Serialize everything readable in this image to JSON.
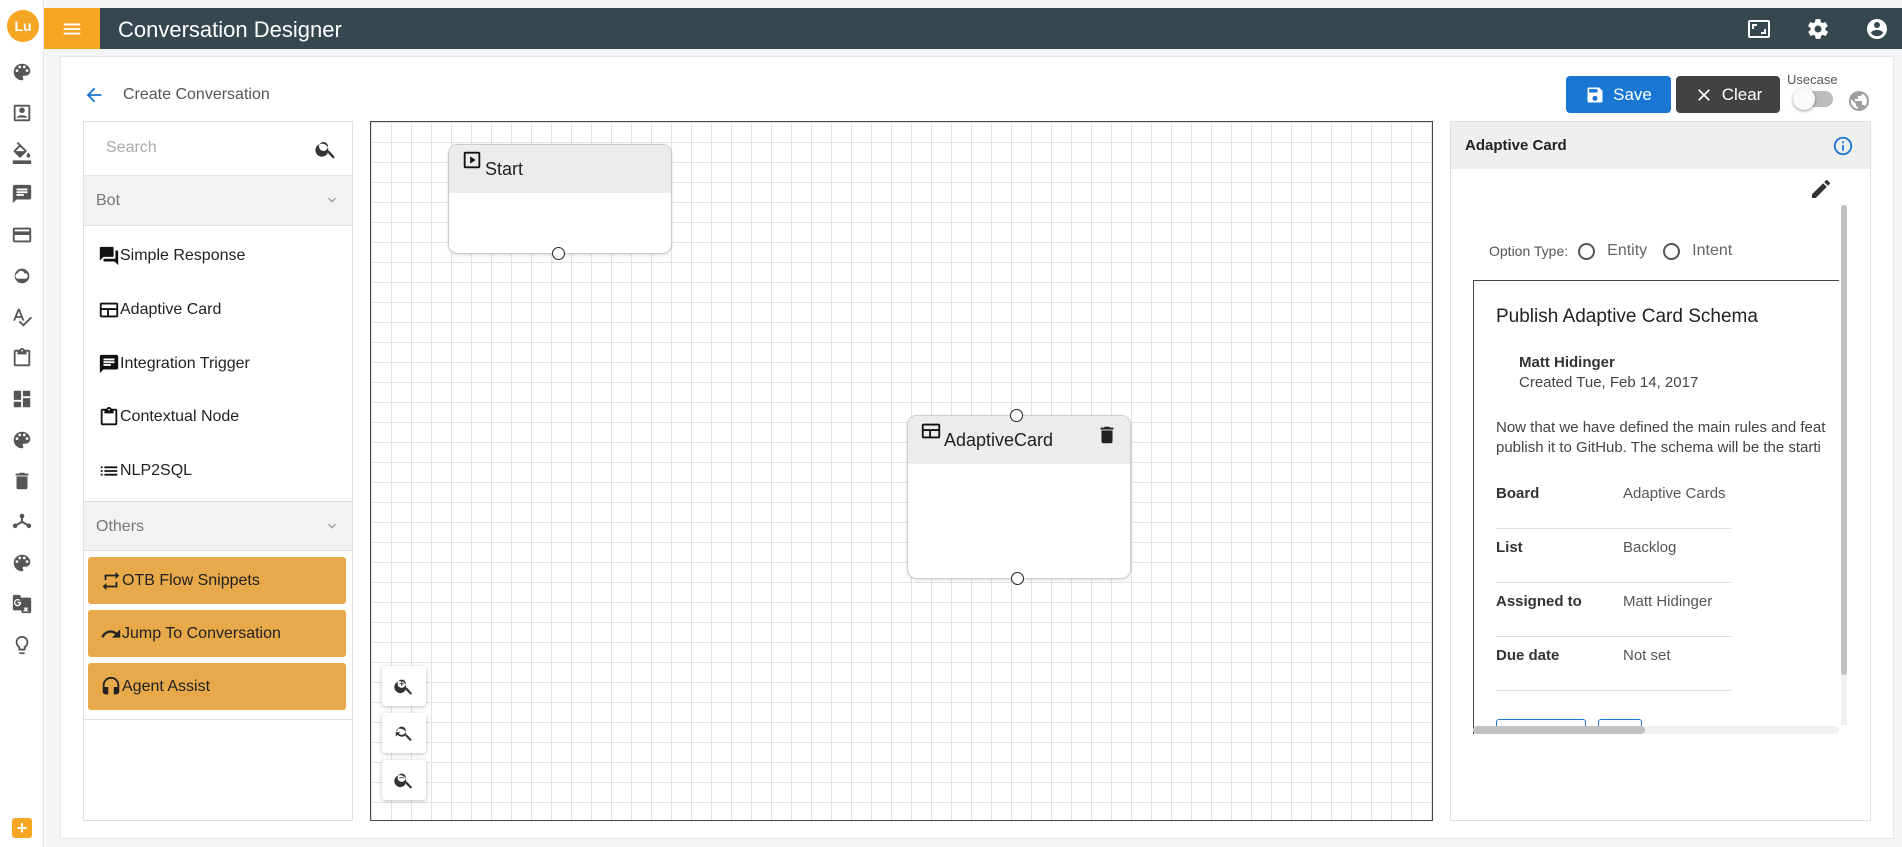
{
  "app": {
    "logo_text": "Lu",
    "title": "Conversation Designer"
  },
  "header": {
    "breadcrumb": "Create Conversation",
    "save_label": "Save",
    "clear_label": "Clear",
    "usecase_label": "Usecase",
    "usecase_enabled": false
  },
  "palette": {
    "search_placeholder": "Search",
    "bot_section": "Bot",
    "bot_items": [
      {
        "label": "Simple Response",
        "icon": "chat-bubbles-icon"
      },
      {
        "label": "Adaptive Card",
        "icon": "card-icon"
      },
      {
        "label": "Integration Trigger",
        "icon": "message-icon"
      },
      {
        "label": "Contextual Node",
        "icon": "clipboard-icon"
      },
      {
        "label": "NLP2SQL",
        "icon": "list-icon"
      }
    ],
    "others_section": "Others",
    "others_items": [
      {
        "label": "OTB Flow Snippets",
        "icon": "repeat-icon"
      },
      {
        "label": "Jump To Conversation",
        "icon": "redo-icon"
      },
      {
        "label": "Agent Assist",
        "icon": "headset-icon"
      }
    ]
  },
  "canvas": {
    "nodes": [
      {
        "title": "Start",
        "icon": "play-icon"
      },
      {
        "title": "AdaptiveCard",
        "icon": "card-icon"
      }
    ]
  },
  "properties": {
    "title": "Adaptive Card",
    "option_type_label": "Option Type:",
    "option_entity": "Entity",
    "option_intent": "Intent",
    "card": {
      "title": "Publish Adaptive Card Schema",
      "author": "Matt Hidinger",
      "created": "Created Tue, Feb 14, 2017",
      "body_line1": "Now that we have defined the main rules and feat",
      "body_line2": "publish it to GitHub. The schema will be the starti",
      "facts": [
        {
          "key": "Board",
          "value": "Adaptive Cards"
        },
        {
          "key": "List",
          "value": "Backlog"
        },
        {
          "key": "Assigned to",
          "value": "Matt Hidinger"
        },
        {
          "key": "Due date",
          "value": "Not set"
        }
      ]
    }
  },
  "colors": {
    "accent": "#f5a623",
    "topbar": "#37474f",
    "primary": "#1976d2",
    "clear_button": "#424242",
    "others_item": "#e8a94a"
  }
}
